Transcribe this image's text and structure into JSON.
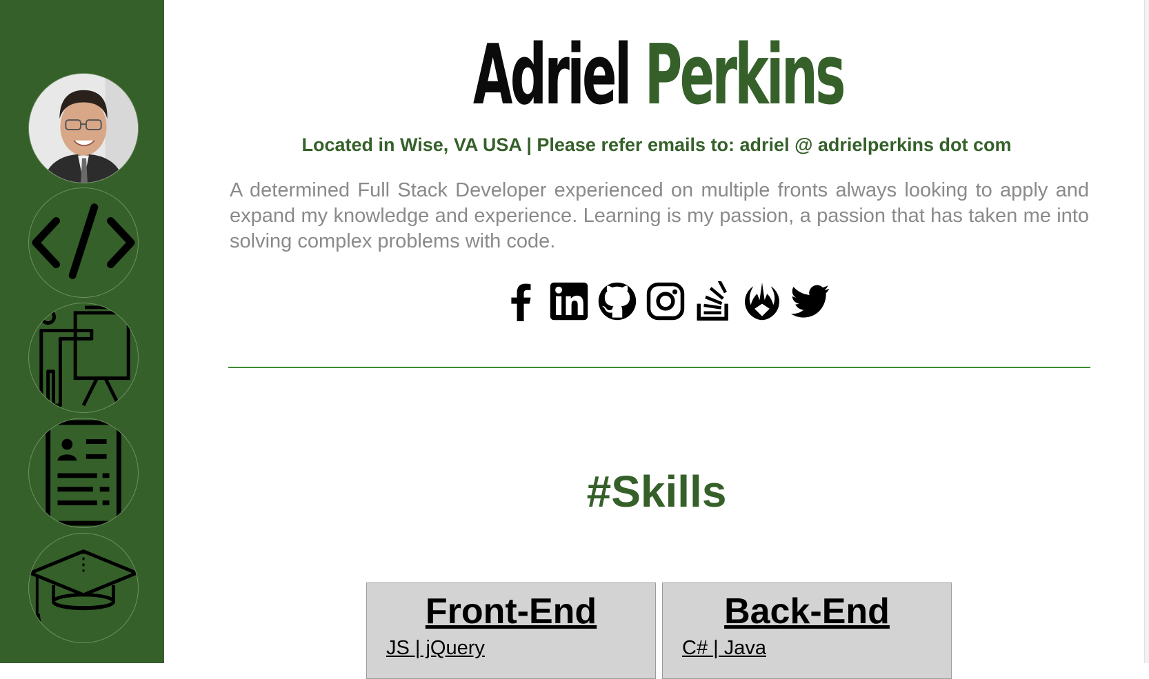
{
  "header": {
    "first_name": "Adriel",
    "last_name": "Perkins",
    "location": "Located in Wise, VA USA | Please refer emails to: adriel @ adrielperkins dot com",
    "bio": "A determined Full Stack Developer experienced on multiple fronts always looking to apply and expand my knowledge and experience. Learning is my passion, a passion that has taken me into solving complex problems with code."
  },
  "sidebar": {
    "items": [
      {
        "icon": "avatar"
      },
      {
        "icon": "code-icon"
      },
      {
        "icon": "teaching-icon"
      },
      {
        "icon": "resume-icon"
      },
      {
        "icon": "graduation-cap-icon"
      }
    ]
  },
  "socials": [
    {
      "icon": "facebook-icon"
    },
    {
      "icon": "linkedin-icon"
    },
    {
      "icon": "github-icon"
    },
    {
      "icon": "instagram-icon"
    },
    {
      "icon": "stackoverflow-icon"
    },
    {
      "icon": "jedi-order-icon"
    },
    {
      "icon": "twitter-icon"
    }
  ],
  "skills": {
    "title": "#Skills",
    "cards": [
      {
        "title": "Front-End",
        "first_item": "JS | jQuery"
      },
      {
        "title": "Back-End",
        "first_item": "C# | Java"
      }
    ]
  },
  "colors": {
    "brand_green": "#35602a",
    "divider_green": "#3f8a33",
    "bio_gray": "#8a8a8a",
    "card_gray": "#d3d3d3"
  }
}
